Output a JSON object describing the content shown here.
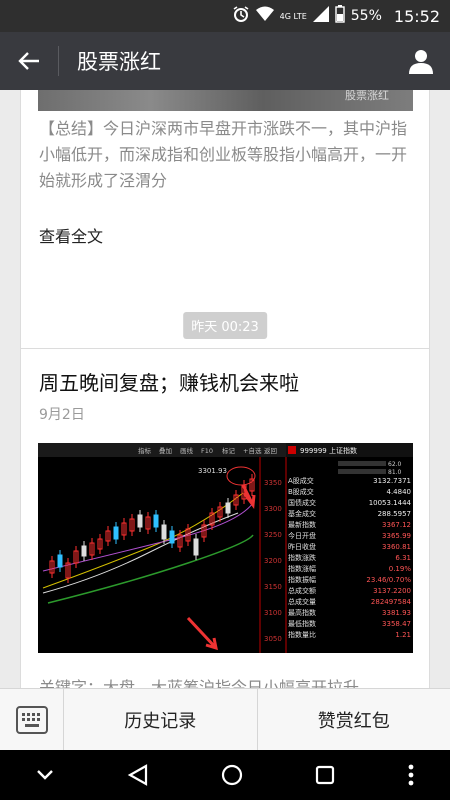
{
  "status_bar": {
    "network": "4G LTE",
    "battery": "55%",
    "time": "15:52"
  },
  "app_bar": {
    "title": "股票涨红"
  },
  "feed": {
    "card1": {
      "watermark": "股票涨红",
      "summary": "【总结】今日沪深两市早盘开市涨跌不一，其中沪指小幅低开，而深成指和创业板等股指小幅高开，一开始就形成了泾渭分",
      "read_more": "查看全文"
    },
    "timestamp": "昨天 00:23",
    "card2": {
      "headline": "周五晚间复盘；赚钱机会来啦",
      "date": "9月2日",
      "keywords": "关键字；大盘，大蓝筹沪指今日小幅高开拉升",
      "chart": {
        "toolbar": [
          "指标",
          "叠加",
          "画线",
          "F10",
          "标记",
          "+自选",
          "返回"
        ],
        "code_header": "999999 上证指数",
        "ratio": [
          "62.0",
          "81.0"
        ],
        "high_label": "3301.93",
        "price_axis": [
          "3350",
          "3300",
          "3250",
          "3200",
          "3150",
          "3100",
          "3050"
        ],
        "stats": [
          {
            "label": "A股成交",
            "value": "3132.7371"
          },
          {
            "label": "B股成交",
            "value": "4.4840"
          },
          {
            "label": "国债成交",
            "value": "10053.1444"
          },
          {
            "label": "基金成交",
            "value": "288.5957"
          },
          {
            "label": "最新指数",
            "value": "3367.12"
          },
          {
            "label": "今日开盘",
            "value": "3365.99"
          },
          {
            "label": "昨日收盘",
            "value": "3360.81"
          },
          {
            "label": "指数涨跌",
            "value": "6.31"
          },
          {
            "label": "指数涨幅",
            "value": "0.19%"
          },
          {
            "label": "指数振幅",
            "value": "23.46/0.70%"
          },
          {
            "label": "总成交额",
            "value": "3137.2200"
          },
          {
            "label": "总成交量",
            "value": "282497584"
          },
          {
            "label": "最高指数",
            "value": "3381.93"
          },
          {
            "label": "最低指数",
            "value": "3358.47"
          },
          {
            "label": "指数量比",
            "value": "1.21"
          }
        ]
      }
    }
  },
  "bottom_menu": {
    "history": "历史记录",
    "reward": "赞赏红包"
  }
}
